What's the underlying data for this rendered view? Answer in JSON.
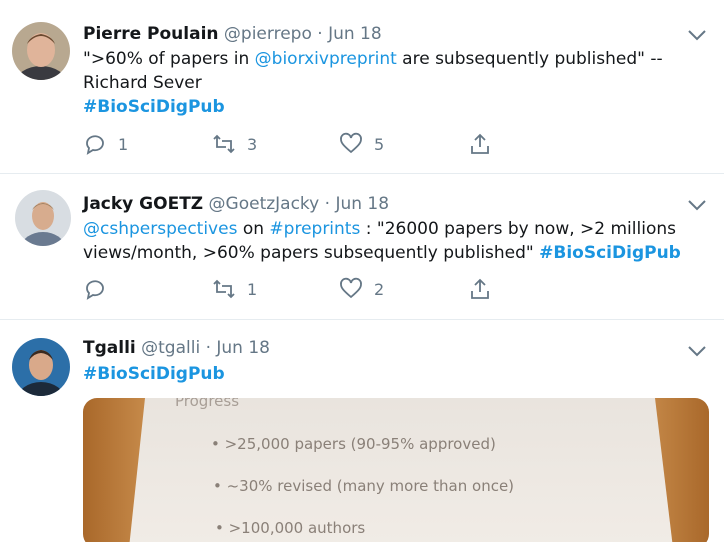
{
  "tweets": [
    {
      "name": "Pierre Poulain",
      "handle": "@pierrepo",
      "dot": "·",
      "date": "Jun 18",
      "text_a": "\">60% of papers in ",
      "mention": "@biorxivpreprint",
      "text_b": " are subsequently published\" -- Richard Sever",
      "hashtag": "#BioSciDigPub",
      "replies": "1",
      "retweets": "3",
      "likes": "5"
    },
    {
      "name": "Jacky GOETZ",
      "handle": "@GoetzJacky",
      "dot": "·",
      "date": "Jun 18",
      "mention": "@cshperspectives",
      "text_a": " on ",
      "hashtag_inline": "#preprints",
      "text_b": " : \"26000 papers by now, >2 millions views/month, >60% papers subsequently published\" ",
      "hashtag": "#BioSciDigPub",
      "replies": "",
      "retweets": "1",
      "likes": "2"
    },
    {
      "name": "Tgalli",
      "handle": "@tgalli",
      "dot": "·",
      "date": "Jun 18",
      "hashtag": "#BioSciDigPub"
    }
  ],
  "media": {
    "heading": "Progress",
    "lines": [
      "• >25,000 papers (90-95% approved)",
      "• ~30% revised (many more than once)",
      "• >100,000 authors"
    ]
  },
  "colors": {
    "link": "#1b95e0",
    "muted": "#657786",
    "divider": "#e6ecf0"
  }
}
